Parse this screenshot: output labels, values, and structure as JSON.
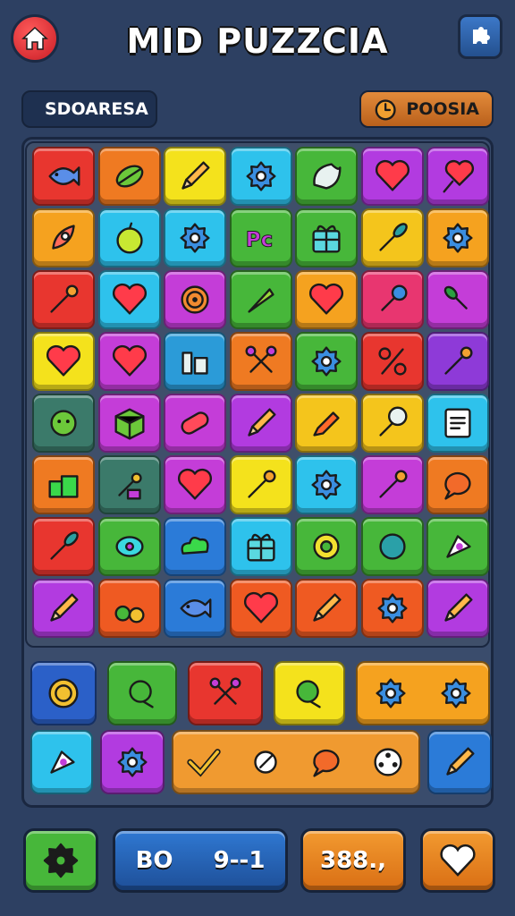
{
  "header": {
    "title": "MID PUZZCIA",
    "home_icon": "home-icon",
    "settings_icon": "puzzle-gear-icon"
  },
  "score_pill": {
    "label": "SDOARESA",
    "icon": "battery-icon"
  },
  "points_pill": {
    "label": "POOSIA",
    "icon": "timer-icon"
  },
  "board": {
    "rows": [
      [
        {
          "icon": "fish",
          "color": "#e8362f"
        },
        {
          "icon": "leaf",
          "color": "#ef7a22"
        },
        {
          "icon": "pencil",
          "color": "#f4e21c"
        },
        {
          "icon": "gear",
          "color": "#2ec2ec"
        },
        {
          "icon": "shell",
          "color": "#47b73a"
        },
        {
          "icon": "heart",
          "color": "#b23be0"
        },
        {
          "icon": "heart-brush",
          "color": "#b23be0"
        }
      ],
      [
        {
          "icon": "rocket",
          "color": "#f5a21f"
        },
        {
          "icon": "apple",
          "color": "#2ec2ec"
        },
        {
          "icon": "gear",
          "color": "#2ec2ec"
        },
        {
          "icon": "letters",
          "color": "#47b73a"
        },
        {
          "icon": "gift",
          "color": "#47b73a"
        },
        {
          "icon": "brush",
          "color": "#f4c51c"
        },
        {
          "icon": "gear",
          "color": "#f5a21f"
        }
      ],
      [
        {
          "icon": "pin",
          "color": "#e8362f"
        },
        {
          "icon": "heart",
          "color": "#2ec2ec"
        },
        {
          "icon": "spiral",
          "color": "#c43dd8"
        },
        {
          "icon": "carrot",
          "color": "#47b73a"
        },
        {
          "icon": "heart",
          "color": "#f5a21f"
        },
        {
          "icon": "wrench",
          "color": "#e83670"
        },
        {
          "icon": "paint-brush",
          "color": "#c43dd8"
        }
      ],
      [
        {
          "icon": "heart",
          "color": "#f4e21c"
        },
        {
          "icon": "heart",
          "color": "#c43dd8"
        },
        {
          "icon": "tools",
          "color": "#2b9bd8"
        },
        {
          "icon": "scissors",
          "color": "#ef7a22"
        },
        {
          "icon": "gear",
          "color": "#47b73a"
        },
        {
          "icon": "percent",
          "color": "#e8362f"
        },
        {
          "icon": "pin",
          "color": "#8e3ad8"
        }
      ],
      [
        {
          "icon": "face",
          "color": "#3b7a6a"
        },
        {
          "icon": "cube",
          "color": "#c43dd8"
        },
        {
          "icon": "pill",
          "color": "#c43dd8"
        },
        {
          "icon": "pencil",
          "color": "#b23be0"
        },
        {
          "icon": "crayon",
          "color": "#f4c51c"
        },
        {
          "icon": "pushpin",
          "color": "#f4c51c"
        },
        {
          "icon": "document",
          "color": "#2ec2ec"
        }
      ],
      [
        {
          "icon": "blocks",
          "color": "#ef7a22"
        },
        {
          "icon": "paint",
          "color": "#3b7a6a"
        },
        {
          "icon": "heart",
          "color": "#c43dd8"
        },
        {
          "icon": "pin",
          "color": "#f4e21c"
        },
        {
          "icon": "gear",
          "color": "#2ec2ec"
        },
        {
          "icon": "pin",
          "color": "#c43dd8"
        },
        {
          "icon": "bubble",
          "color": "#ef7a22"
        }
      ],
      [
        {
          "icon": "brush",
          "color": "#e8362f"
        },
        {
          "icon": "blob",
          "color": "#47b73a"
        },
        {
          "icon": "cloud",
          "color": "#2b7bd8"
        },
        {
          "icon": "gift",
          "color": "#2ec2ec"
        },
        {
          "icon": "ring",
          "color": "#47b73a"
        },
        {
          "icon": "ball",
          "color": "#47b73a"
        },
        {
          "icon": "cone",
          "color": "#47b73a"
        }
      ],
      [
        {
          "icon": "pencil",
          "color": "#b23be0"
        },
        {
          "icon": "cherries",
          "color": "#ef5a22"
        },
        {
          "icon": "fish",
          "color": "#2b7bd8"
        },
        {
          "icon": "heart",
          "color": "#ef5a22"
        },
        {
          "icon": "pencil",
          "color": "#ef5a22"
        },
        {
          "icon": "gear",
          "color": "#ef5a22"
        },
        {
          "icon": "pencil",
          "color": "#b23be0"
        }
      ]
    ]
  },
  "tray": {
    "row1": [
      {
        "icons": [
          "coin"
        ],
        "color": "#2b60c8",
        "width": 74
      },
      {
        "icons": [
          "bird"
        ],
        "color": "#47b73a",
        "width": 78
      },
      {
        "icons": [
          "scissors"
        ],
        "color": "#e8362f",
        "width": 84
      },
      {
        "icons": [
          "bird"
        ],
        "color": "#f4e21c",
        "width": 80
      },
      {
        "icons": [
          "gear",
          "gear"
        ],
        "color": "#f5a21f",
        "width": 150
      }
    ],
    "row2": [
      {
        "icons": [
          "cone"
        ],
        "color": "#2ec2ec",
        "width": 70
      },
      {
        "icons": [
          "gear"
        ],
        "color": "#b23be0",
        "width": 72
      },
      {
        "icons": [
          "check",
          "refresh",
          "bubble",
          "film"
        ],
        "color": "#f09a30",
        "width": 278
      },
      {
        "icons": [
          "pencil"
        ],
        "color": "#2b7bd8",
        "width": 72
      }
    ]
  },
  "bottom_bar": {
    "settings_icon": "gear-icon",
    "level_label": "BO",
    "level_value": "9--1",
    "score_value": "388.,",
    "favorite_icon": "heart-icon"
  }
}
